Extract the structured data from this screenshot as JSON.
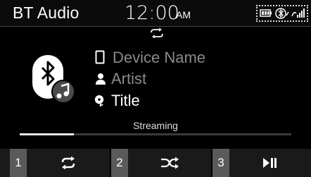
{
  "status": {
    "source": "BT Audio",
    "time": "12:00",
    "ampm": "AM"
  },
  "track": {
    "device_name": "Device Name",
    "artist": "Artist",
    "title": "Title",
    "status": "Streaming",
    "progress": 0.2
  },
  "presets": [
    {
      "number": "1",
      "icon": "repeat-icon"
    },
    {
      "number": "2",
      "icon": "shuffle-icon"
    },
    {
      "number": "3",
      "icon": "play-pause-icon"
    }
  ],
  "colors": {
    "background": "#000000",
    "secondary_text": "#8a8a8a",
    "button_number_bg": "#5a5a5a",
    "bottom_bar_bg": "#1a1a1a"
  }
}
